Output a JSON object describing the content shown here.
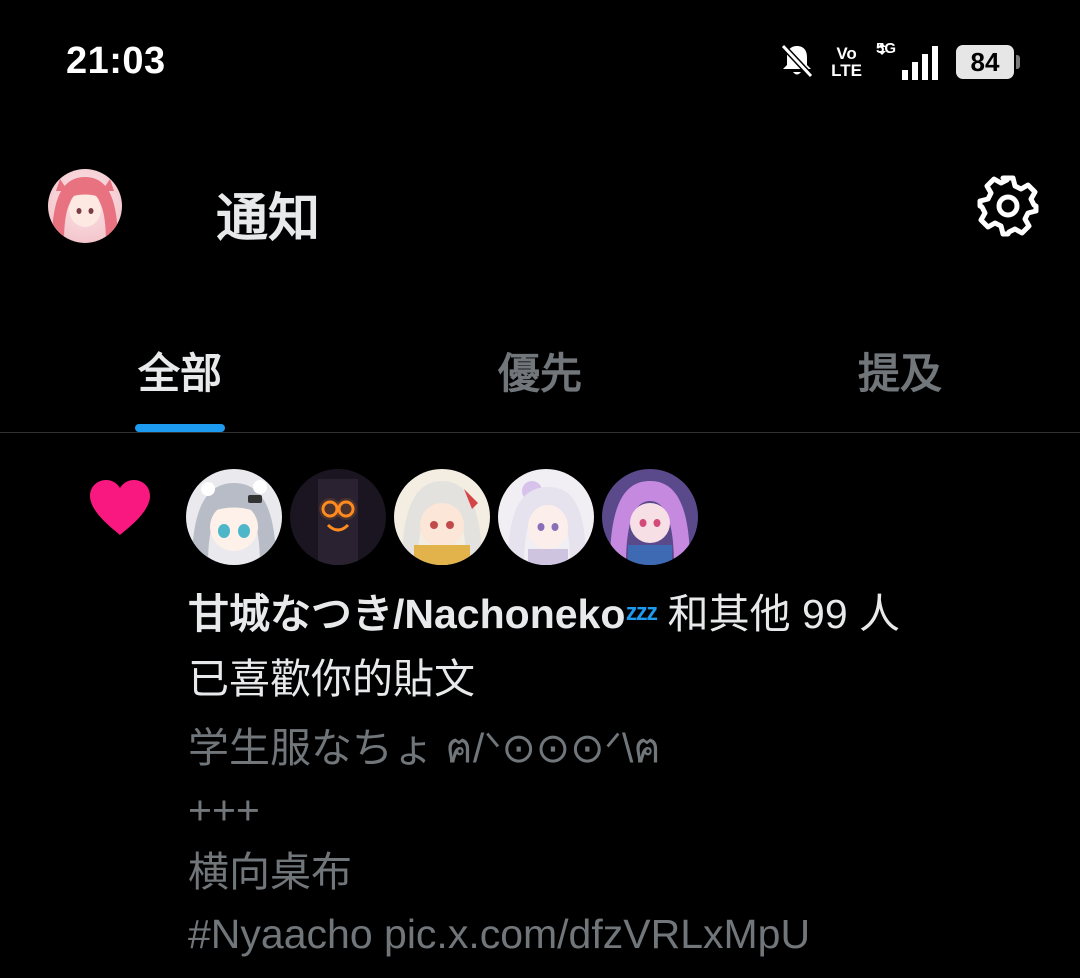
{
  "status_bar": {
    "time": "21:03",
    "volte_top": "Vo",
    "volte_bottom": "LTE",
    "network": "5G",
    "battery": "84",
    "icons": [
      "bell-muted-icon",
      "volte-icon",
      "signal-5g-icon",
      "battery-icon"
    ]
  },
  "header": {
    "title": "通知",
    "settings_icon": "gear-icon"
  },
  "tabs": [
    {
      "label": "全部",
      "active": true
    },
    {
      "label": "優先",
      "active": false
    },
    {
      "label": "提及",
      "active": false
    }
  ],
  "colors": {
    "accent": "#1d9bf0",
    "like": "#f91880",
    "text_primary": "#e7e9ea",
    "text_secondary": "#71767b",
    "background": "#000000"
  },
  "notification": {
    "type_icon": "heart-icon",
    "actor": "甘城なつき/Nachoneko",
    "actor_emoji": "💤",
    "others_text": "和其他 99 人",
    "action_text": "已喜歡你的貼文",
    "post_lines": [
      "学生服なちょ ฅ/ᐠ⊙⊙⊙ᐟ\\ฅ",
      "+++",
      "横向桌布",
      "#Nyaacho pic.x.com/dfzVRLxMpU"
    ]
  }
}
